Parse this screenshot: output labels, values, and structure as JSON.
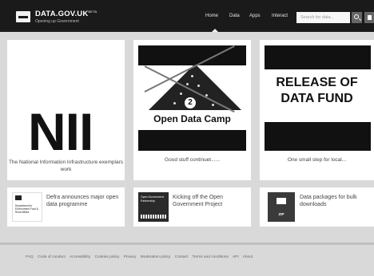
{
  "header": {
    "site_name": "DATA.GOV.UK",
    "site_name_sup": "BETA",
    "tagline": "Opening up Government",
    "nav": [
      "Home",
      "Data",
      "Apps",
      "Interact"
    ],
    "search_placeholder": "Search for data..."
  },
  "icons": {
    "logo": "crown-logo-icon",
    "search": "search-icon",
    "user": "user-icon"
  },
  "featured": [
    {
      "image_text": "NII",
      "caption": "The National Information Infrastructure exemplars work"
    },
    {
      "image_text": "Open Data Camp",
      "badge_number": "2",
      "caption": "Good stuff continuet......"
    },
    {
      "image_text_line1": "RELEASE OF",
      "image_text_line2": "DATA FUND",
      "caption": "One small step for local..."
    }
  ],
  "news": [
    {
      "logo_text": "Department for Environment Food & Rural Affairs",
      "title": "Defra announces major open data programme"
    },
    {
      "logo_text": "Open Government Partnership",
      "title": "Kicking off the Open Government Project"
    },
    {
      "logo_text": "ZIP",
      "title": "Data packages for bulk downloads"
    }
  ],
  "footer": {
    "links": [
      "FAQ",
      "Code of conduct",
      "Accessibility",
      "Cookies policy",
      "Privacy",
      "Moderation policy",
      "Contact",
      "Terms and conditions",
      "API",
      "About"
    ]
  },
  "colors": {
    "header_bg": "#1a1a1a",
    "page_bg": "#d9d9d9",
    "card_bg": "#ffffff"
  }
}
